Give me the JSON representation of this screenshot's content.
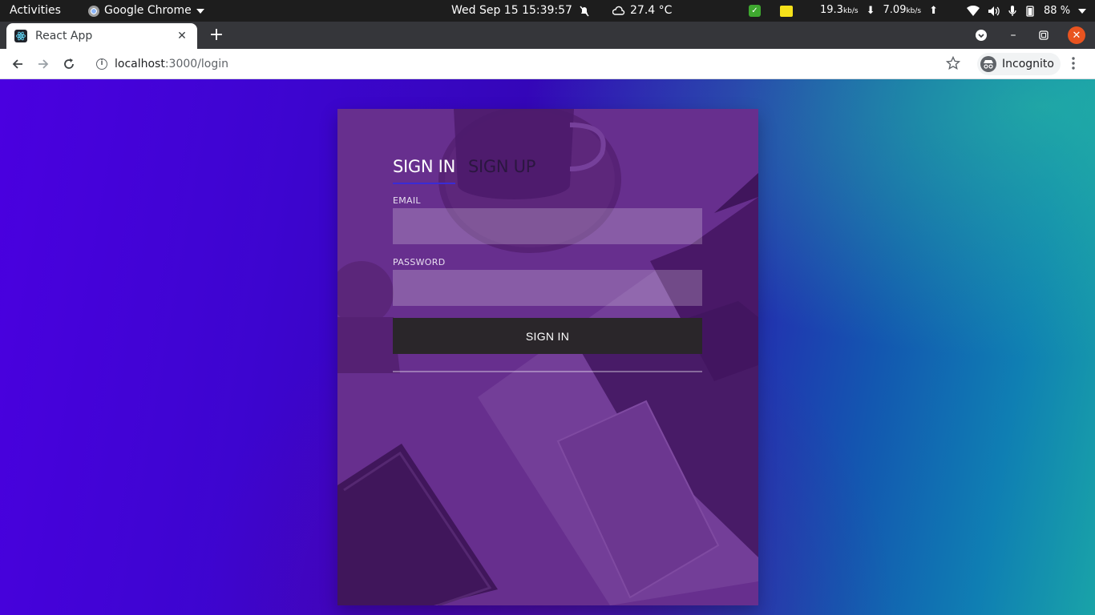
{
  "topbar": {
    "activities": "Activities",
    "app_name": "Google Chrome",
    "datetime": "Wed Sep 15  15:39:57",
    "weather": "27.4 °C",
    "net_down_value": "19.3",
    "net_unit": "kb/s",
    "net_up_value": "7.09",
    "battery": "88 %"
  },
  "browser": {
    "tab_title": "React App",
    "url_host": "localhost",
    "url_path": ":3000/login",
    "incognito_label": "Incognito"
  },
  "login": {
    "tab_signin": "SIGN IN",
    "tab_signup": "SIGN UP",
    "email_label": "EMAIL",
    "email_value": "",
    "password_label": "PASSWORD",
    "password_value": "",
    "submit_label": "SIGN IN"
  },
  "colors": {
    "accent_underline": "#3a2bd6",
    "card_tint": "#5f2a86",
    "button_bg": "#2a262a"
  }
}
